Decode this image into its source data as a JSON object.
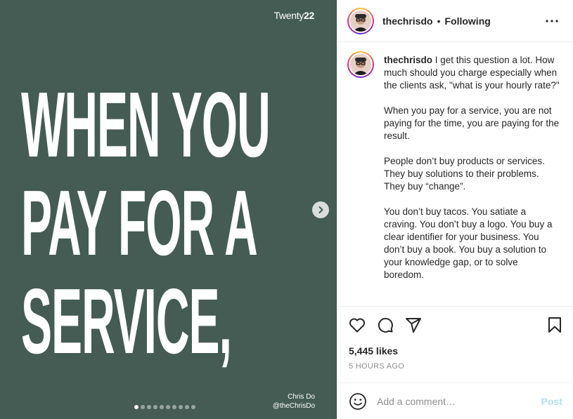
{
  "post_image": {
    "brand_prefix": "Twenty",
    "brand_suffix": "22",
    "headline_lines": [
      "WHEN YOU",
      "PAY FOR A",
      "SERVICE,"
    ],
    "credit_name": "Chris Do",
    "credit_handle": "@theChrisDo",
    "slide_count": 10,
    "active_slide": 1,
    "background_color": "#445c53",
    "next_icon": "chevron-right-icon"
  },
  "header": {
    "username": "thechrisdo",
    "separator": "•",
    "follow_status": "Following",
    "more_icon": "more-options-icon"
  },
  "caption": {
    "username": "thechrisdo",
    "text": " I get this question a lot. How much should you charge especially when the clients ask, \"what is your hourly rate?\"\n\nWhen you pay for a service, you are not paying for the time, you are paying for the result.\n\nPeople don’t buy products or services. They buy solutions to their problems. They buy “change”.\n\nYou don’t buy tacos. You satiate a craving. You don’t buy a logo. You buy a clear identifier for your business. You don’t buy a book. You buy a solution to your knowledge gap, or to solve boredom."
  },
  "actions": {
    "like_icon": "heart-icon",
    "comment_icon": "comment-icon",
    "share_icon": "share-icon",
    "save_icon": "bookmark-icon"
  },
  "likes": "5,445 likes",
  "timestamp": "5 HOURS AGO",
  "comment_bar": {
    "emoji_icon": "emoji-icon",
    "placeholder": "Add a comment…",
    "post_label": "Post",
    "post_color": "#b2dffc"
  }
}
